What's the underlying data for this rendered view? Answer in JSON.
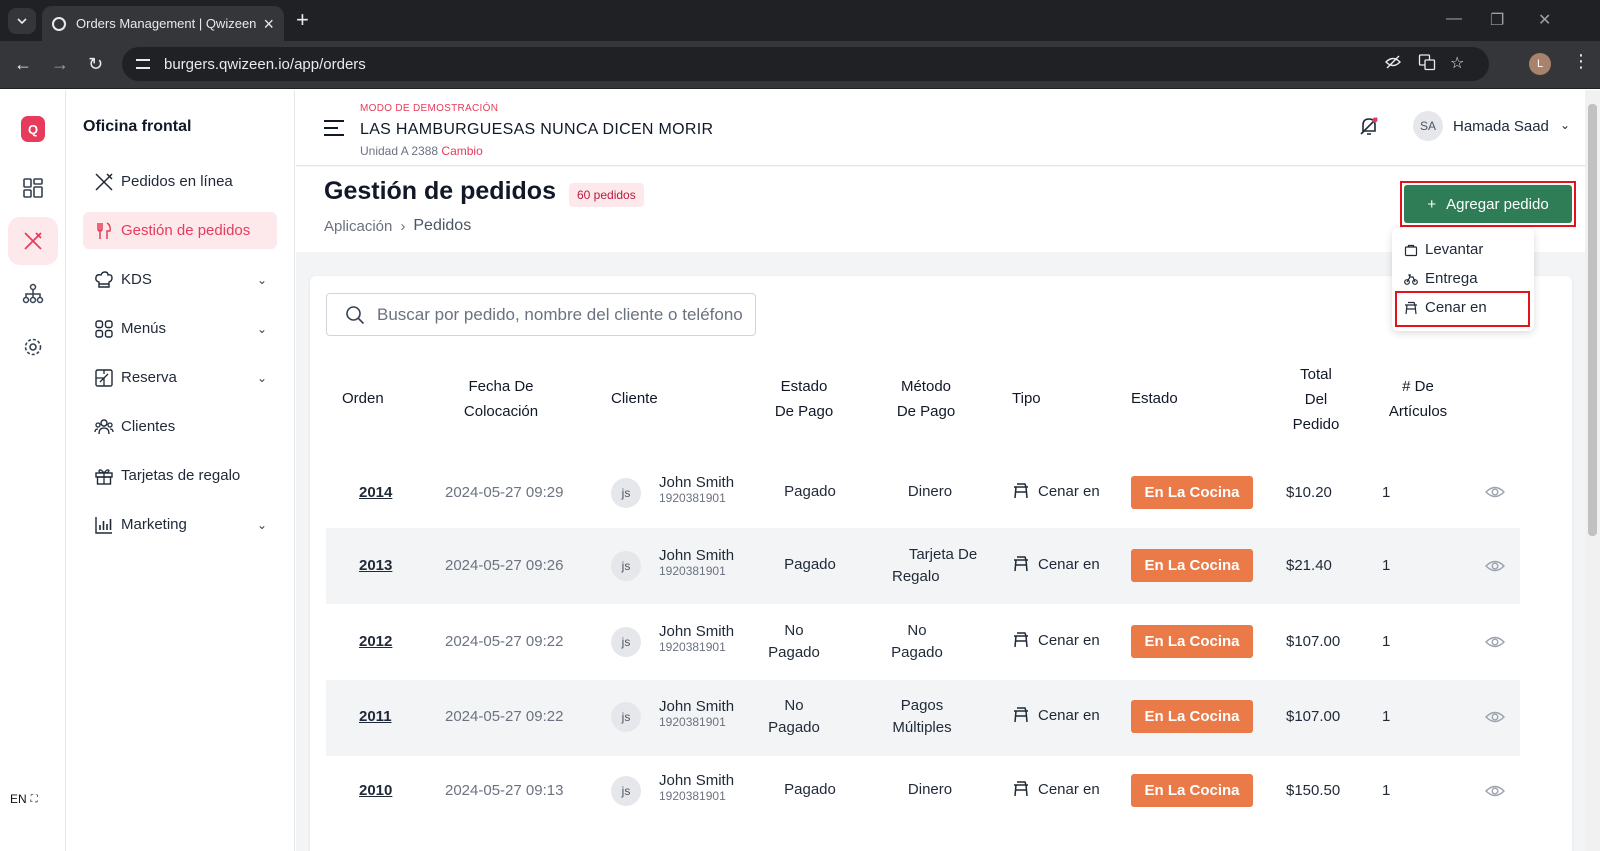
{
  "browser": {
    "tab_title": "Orders Management | Qwizeen",
    "url": "burgers.qwizeen.io/app/orders",
    "profile_initial": "L"
  },
  "rail": {
    "logo_letter": "Q",
    "language": "EN"
  },
  "sidebar": {
    "title": "Oficina frontal",
    "items": [
      {
        "label": "Pedidos en línea"
      },
      {
        "label": "Gestión de pedidos"
      },
      {
        "label": "KDS"
      },
      {
        "label": "Menús"
      },
      {
        "label": "Reserva"
      },
      {
        "label": "Clientes"
      },
      {
        "label": "Tarjetas de regalo"
      },
      {
        "label": "Marketing"
      }
    ]
  },
  "topbar": {
    "demo_mode": "MODO DE DEMOSTRACIÓN",
    "restaurant_name": "LAS HAMBURGUESAS NUNCA DICEN MORIR",
    "unit": "Unidad A 2388",
    "change": "Cambio",
    "user_initials": "SA",
    "user_name": "Hamada Saad"
  },
  "page": {
    "title": "Gestión de pedidos",
    "count_badge": "60 pedidos",
    "breadcrumb": [
      "Aplicación",
      "Pedidos"
    ],
    "add_button": "Agregar pedido",
    "add_button_icon": "+"
  },
  "dropdown": {
    "items": [
      {
        "label": "Levantar",
        "icon": "bag-icon"
      },
      {
        "label": "Entrega",
        "icon": "bike-icon"
      },
      {
        "label": "Cenar en",
        "icon": "table-icon"
      }
    ]
  },
  "search": {
    "placeholder": "Buscar por pedido, nombre del cliente o teléfono"
  },
  "table": {
    "headers": {
      "order": "Orden",
      "date_1": "Fecha De",
      "date_2": "Colocación",
      "customer": "Cliente",
      "pay_status_1": "Estado",
      "pay_status_2": "De Pago",
      "pay_method_1": "Método",
      "pay_method_2": "De Pago",
      "type": "Tipo",
      "status": "Estado",
      "total_1": "Total",
      "total_2": "Del",
      "total_3": "Pedido",
      "items_1": "# De",
      "items_2": "Artículos"
    },
    "rows": [
      {
        "order": "2014",
        "date": "2024-05-27 09:29",
        "initials": "js",
        "name": "John Smith",
        "phone": "1920381901",
        "pay_status_1": "Pagado",
        "pay_status_2": "",
        "pay_method_1": "Dinero",
        "pay_method_2": "",
        "type": "Cenar en",
        "status": "En La Cocina",
        "total": "$10.20",
        "items": "1"
      },
      {
        "order": "2013",
        "date": "2024-05-27 09:26",
        "initials": "js",
        "name": "John Smith",
        "phone": "1920381901",
        "pay_status_1": "Pagado",
        "pay_status_2": "",
        "pay_method_1": "Tarjeta De",
        "pay_method_2": "Regalo",
        "type": "Cenar en",
        "status": "En La Cocina",
        "total": "$21.40",
        "items": "1"
      },
      {
        "order": "2012",
        "date": "2024-05-27 09:22",
        "initials": "js",
        "name": "John Smith",
        "phone": "1920381901",
        "pay_status_1": "No",
        "pay_status_2": "Pagado",
        "pay_method_1": "No",
        "pay_method_2": "Pagado",
        "type": "Cenar en",
        "status": "En La Cocina",
        "total": "$107.00",
        "items": "1"
      },
      {
        "order": "2011",
        "date": "2024-05-27 09:22",
        "initials": "js",
        "name": "John Smith",
        "phone": "1920381901",
        "pay_status_1": "No",
        "pay_status_2": "Pagado",
        "pay_method_1": "Pagos",
        "pay_method_2": "Múltiples",
        "type": "Cenar en",
        "status": "En La Cocina",
        "total": "$107.00",
        "items": "1"
      },
      {
        "order": "2010",
        "date": "2024-05-27 09:13",
        "initials": "js",
        "name": "John Smith",
        "phone": "1920381901",
        "pay_status_1": "Pagado",
        "pay_status_2": "",
        "pay_method_1": "Dinero",
        "pay_method_2": "",
        "type": "Cenar en",
        "status": "En La Cocina",
        "total": "$150.50",
        "items": "1"
      }
    ]
  },
  "colors": {
    "brand": "#e63b5a",
    "primary_button": "#2e7d57",
    "status_kitchen": "#ea7a48",
    "highlight_frame": "#e3131b"
  }
}
